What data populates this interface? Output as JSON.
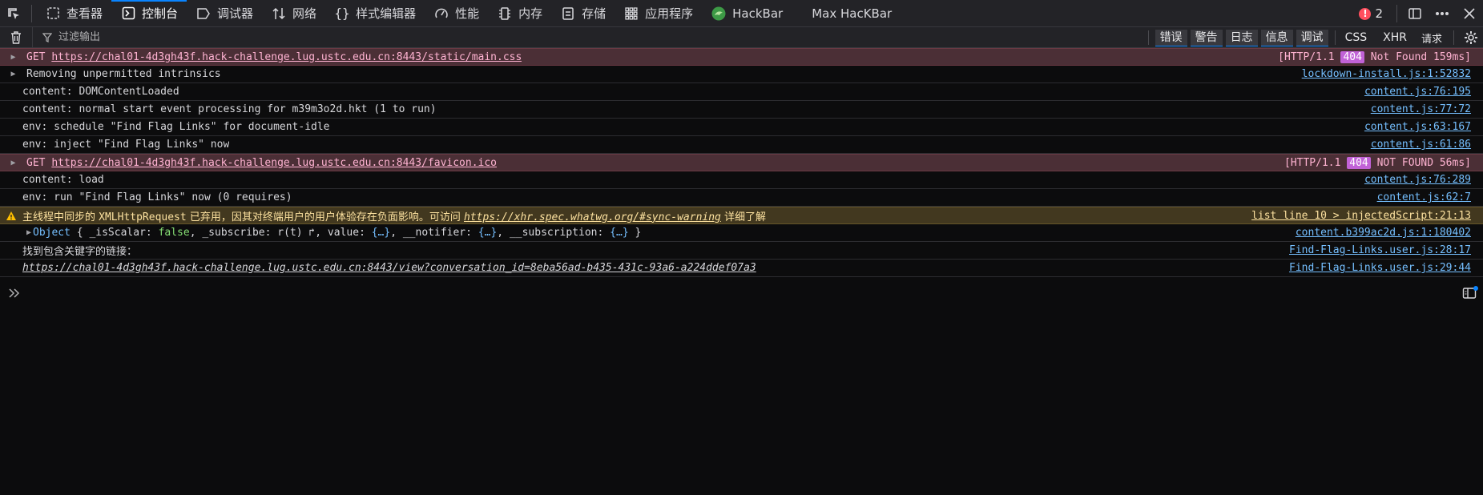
{
  "tabs": [
    {
      "id": "inspector",
      "label": "查看器",
      "icon": "inspector-icon"
    },
    {
      "id": "console",
      "label": "控制台",
      "icon": "console-icon",
      "selected": true
    },
    {
      "id": "debugger",
      "label": "调试器",
      "icon": "debugger-icon"
    },
    {
      "id": "network",
      "label": "网络",
      "icon": "network-icon"
    },
    {
      "id": "style",
      "label": "样式编辑器",
      "icon": "style-editor-icon"
    },
    {
      "id": "performance",
      "label": "性能",
      "icon": "performance-icon"
    },
    {
      "id": "memory",
      "label": "内存",
      "icon": "memory-icon"
    },
    {
      "id": "storage",
      "label": "存储",
      "icon": "storage-icon"
    },
    {
      "id": "application",
      "label": "应用程序",
      "icon": "application-icon"
    },
    {
      "id": "hackbar",
      "label": "HackBar",
      "icon": "hackbar-icon"
    },
    {
      "id": "maxhackbar",
      "label": "Max HacKBar"
    }
  ],
  "error_count": "2",
  "toolbar": {
    "filter_placeholder": "过滤输出",
    "levels": [
      "错误",
      "警告",
      "日志",
      "信息",
      "调试"
    ],
    "css": "CSS",
    "xhr": "XHR",
    "requests": "请求"
  },
  "rows": {
    "r1": {
      "method": "GET",
      "url": "https://chal01-4d3gh43f.hack-challenge.lug.ustc.edu.cn:8443/static/main.css",
      "loc_pre": "[HTTP/1.1",
      "status": "404",
      "loc_post": "Not Found 159ms]"
    },
    "r2": {
      "msg": "Removing unpermitted intrinsics",
      "loc": "lockdown-install.js:1:52832"
    },
    "r3": {
      "msg": "content: DOMContentLoaded",
      "loc": "content.js:76:195"
    },
    "r4": {
      "msg": "content: normal start event processing for m39m3o2d.hkt (1 to run)",
      "loc": "content.js:77:72"
    },
    "r5": {
      "msg": "env: schedule \"Find Flag Links\" for document-idle",
      "loc": "content.js:63:167"
    },
    "r6": {
      "msg": "env: inject \"Find Flag Links\" now",
      "loc": "content.js:61:86"
    },
    "r7": {
      "method": "GET",
      "url": "https://chal01-4d3gh43f.hack-challenge.lug.ustc.edu.cn:8443/favicon.ico",
      "loc_pre": "[HTTP/1.1",
      "status": "404",
      "loc_post": "NOT FOUND 56ms]"
    },
    "r8": {
      "msg": "content: load",
      "loc": "content.js:76:289"
    },
    "r9": {
      "msg": "env: run \"Find Flag Links\" now  (0 requires)",
      "loc": "content.js:62:7"
    },
    "r10": {
      "pre": "主线程中同步的 ",
      "api": "XMLHttpRequest",
      "mid": " 已弃用，因其对终端用户的用户体验存在负面影响。可访问 ",
      "link": "https://xhr.spec.whatwg.org/#sync-warning",
      "post": " 详细了解",
      "loc": "list line 10 > injectedScript:21:13"
    },
    "r11": {
      "obj": "Object",
      "p1": "_isScalar",
      "v1": "false",
      "p2": "_subscribe",
      "v2": "r(t)",
      "p3": "value",
      "v3": "{…}",
      "p4": "__notifier",
      "v4": "{…}",
      "p5": "__subscription",
      "v5": "{…}",
      "loc": "content.b399ac2d.js:1:180402"
    },
    "r12": {
      "msg": "找到包含关键字的链接：",
      "loc": "Find-Flag-Links.user.js:28:17"
    },
    "r13": {
      "msg": "https://chal01-4d3gh43f.hack-challenge.lug.ustc.edu.cn:8443/view?conversation_id=8eba56ad-b435-431c-93a6-a224ddef07a3",
      "loc": "Find-Flag-Links.user.js:29:44"
    }
  },
  "colors": {
    "accent": "#0a84ff",
    "error_bg": "#4b2f36",
    "warn_bg": "#42381f",
    "link": "#75bfff"
  }
}
